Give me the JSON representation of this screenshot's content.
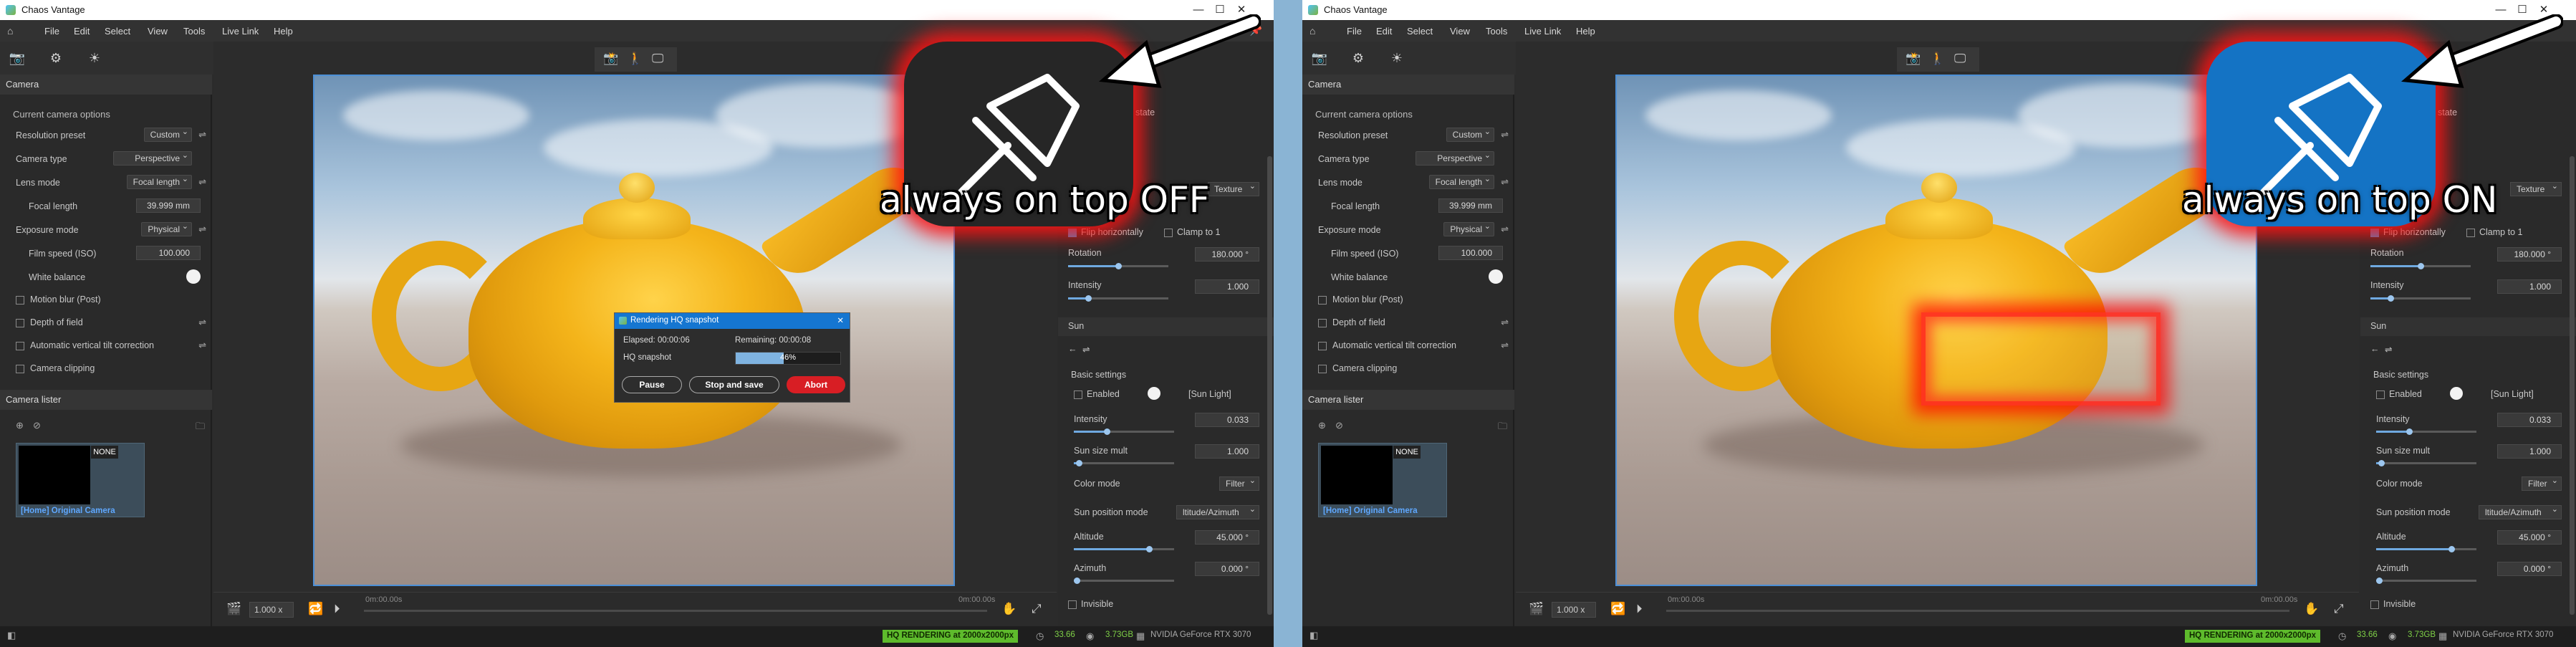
{
  "window": {
    "app_title": "Chaos Vantage",
    "minimize": "—",
    "maximize": "☐",
    "close": "✕"
  },
  "menu": {
    "items": [
      "File",
      "Edit",
      "Select",
      "View",
      "Tools",
      "Live Link",
      "Help"
    ],
    "home_icon": "home-icon",
    "pin_icon": "pin-icon"
  },
  "camera_panel": {
    "header": "Camera",
    "section": "Current camera options",
    "resolution_preset_label": "Resolution preset",
    "resolution_preset_value": "Custom",
    "camera_type_label": "Camera type",
    "camera_type_value": "Perspective",
    "lens_mode_label": "Lens mode",
    "lens_mode_value": "Focal length",
    "focal_length_label": "Focal length",
    "focal_length_value": "39.999 mm",
    "exposure_mode_label": "Exposure mode",
    "exposure_mode_value": "Physical",
    "film_speed_label": "Film speed (ISO)",
    "film_speed_value": "100.000",
    "white_balance_label": "White balance",
    "motion_blur_label": "Motion blur (Post)",
    "depth_of_field_label": "Depth of field",
    "auto_tilt_label": "Automatic vertical tilt correction",
    "camera_clipping_label": "Camera clipping"
  },
  "camera_lister": {
    "header": "Camera lister",
    "badge": "NONE",
    "caption": "[Home] Original Camera"
  },
  "render_dialog": {
    "title": "Rendering HQ snapshot",
    "elapsed": "Elapsed: 00:00:06",
    "remaining": "Remaining: 00:00:08",
    "label": "HQ snapshot",
    "progress": 0.46,
    "progress_text": "46%",
    "pause": "Pause",
    "stop_save": "Stop and save",
    "abort": "Abort"
  },
  "bottombar": {
    "zoom": "1.000 x",
    "time_start": "0m:00.00s",
    "time_end": "0m:00.00s"
  },
  "right_panel": {
    "state_partial": "state",
    "texture_dd": "Texture",
    "flip_horizontally": "Flip horizontally",
    "clamp_to_1": "Clamp to 1",
    "rotation_label": "Rotation",
    "rotation_value": "180.000 °",
    "rotation_level": 0.5,
    "intensity_label": "Intensity",
    "intensity_value": "1.000",
    "intensity_level": 0.2,
    "sun_header": "Sun",
    "basic_settings": "Basic settings",
    "enabled_label": "Enabled",
    "sun_light_tag": "[Sun Light]",
    "sun_intensity_label": "Intensity",
    "sun_intensity_value": "0.033",
    "sun_intensity_level": 0.33,
    "sun_size_label": "Sun size mult",
    "sun_size_value": "1.000",
    "sun_size_level": 0.05,
    "color_mode_label": "Color mode",
    "color_mode_value": "Filter",
    "sun_position_label": "Sun position mode",
    "sun_position_value": "ltitude/Azimuth",
    "altitude_label": "Altitude",
    "altitude_value": "45.000 °",
    "altitude_level": 0.75,
    "azimuth_label": "Azimuth",
    "azimuth_value": "0.000 °",
    "azimuth_level": 0.0,
    "invisible_label": "Invisible"
  },
  "status": {
    "hq_badge": "HQ RENDERING at 2000x2000px",
    "fps": "33.66",
    "memory": "3.73GB",
    "gpu": "NVIDIA GeForce RTX 3070"
  },
  "overlays": {
    "left_caption": "always on top OFF",
    "right_caption": "always on top ON"
  },
  "colors": {
    "accent_blue": "#1473c4",
    "glow_red": "#ff1a1a",
    "hq_green": "#5ebb2c",
    "abort_red": "#d81e24"
  }
}
